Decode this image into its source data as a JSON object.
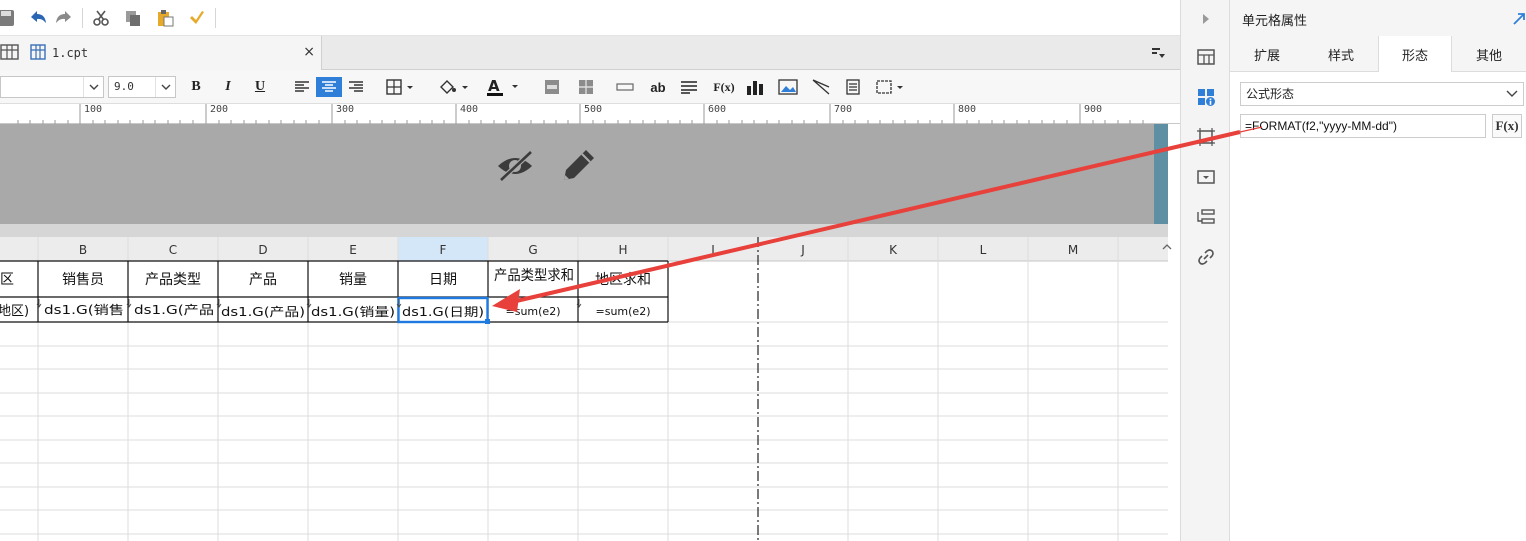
{
  "tab": {
    "title": "1.cpt",
    "close": "×"
  },
  "format_bar": {
    "font_size": "9.0",
    "bold": "B",
    "italic": "I",
    "underline": "U",
    "text_button": "ab",
    "formula_button": "F(x)"
  },
  "ruler": {
    "marks": [
      "100",
      "200",
      "300",
      "400",
      "500",
      "600",
      "700",
      "800",
      "900"
    ]
  },
  "grid": {
    "columns": [
      "B",
      "C",
      "D",
      "E",
      "F",
      "G",
      "H",
      "I",
      "J",
      "K",
      "L",
      "M"
    ],
    "header_row": [
      "区",
      "销售员",
      "产品类型",
      "产品",
      "销量",
      "日期",
      "产品类型求和",
      "地区求和"
    ],
    "data_row": [
      "地区)",
      "ds1.G(销售",
      "ds1.G(产品",
      "ds1.G(产品)",
      "ds1.G(销量)",
      "ds1.G(日期)",
      "=sum(e2)",
      "=sum(e2)"
    ],
    "selected_cell": "F2"
  },
  "panel": {
    "title": "单元格属性",
    "tabs": [
      "扩展",
      "样式",
      "形态",
      "其他"
    ],
    "active_tab": "形态",
    "display_type": "公式形态",
    "formula": "=FORMAT(f2,\"yyyy-MM-dd\")",
    "fx_label": "F(x)"
  },
  "colors": {
    "accent": "#2f7fd8",
    "arrow": "#e8403a",
    "header_band": "#a9a9a9",
    "selection": "#1f7ae0"
  }
}
